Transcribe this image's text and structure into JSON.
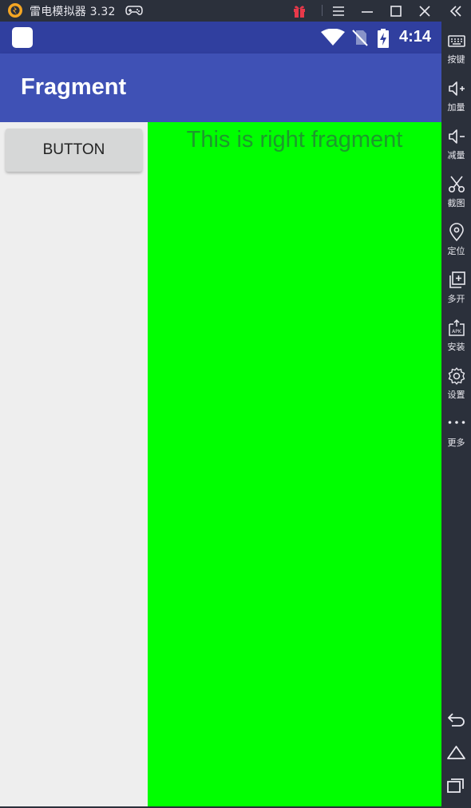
{
  "titlebar": {
    "app_name": "雷电模拟器 3.32",
    "icons": [
      "ldplayer-logo-icon",
      "gamepad-icon",
      "gift-icon",
      "menu-icon",
      "minimize-icon",
      "maximize-icon",
      "close-icon",
      "collapse-icon"
    ]
  },
  "statusbar": {
    "time": "4:14",
    "icons": [
      "notification-icon",
      "wifi-icon",
      "no-sim-icon",
      "battery-charging-icon"
    ]
  },
  "app": {
    "title": "Fragment",
    "button_label": "BUTTON",
    "right_fragment_text": "This is right fragment"
  },
  "sidebar": {
    "items": [
      {
        "label": "按键",
        "icon": "keyboard-icon"
      },
      {
        "label": "加量",
        "icon": "volume-up-icon"
      },
      {
        "label": "减量",
        "icon": "volume-down-icon"
      },
      {
        "label": "截图",
        "icon": "scissors-icon"
      },
      {
        "label": "定位",
        "icon": "location-pin-icon"
      },
      {
        "label": "多开",
        "icon": "multi-instance-icon"
      },
      {
        "label": "安装",
        "icon": "apk-install-icon"
      },
      {
        "label": "设置",
        "icon": "settings-gear-icon"
      },
      {
        "label": "更多",
        "icon": "more-dots-icon"
      }
    ],
    "nav": [
      "back-icon",
      "home-icon",
      "recents-icon"
    ]
  },
  "colors": {
    "statusbar": "#303f9f",
    "appbar": "#3f51b5",
    "right_fragment": "#00ff00",
    "right_fragment_text": "#1d9a2c",
    "left_fragment": "#eeeeee",
    "emulator_chrome": "#2b303b"
  }
}
